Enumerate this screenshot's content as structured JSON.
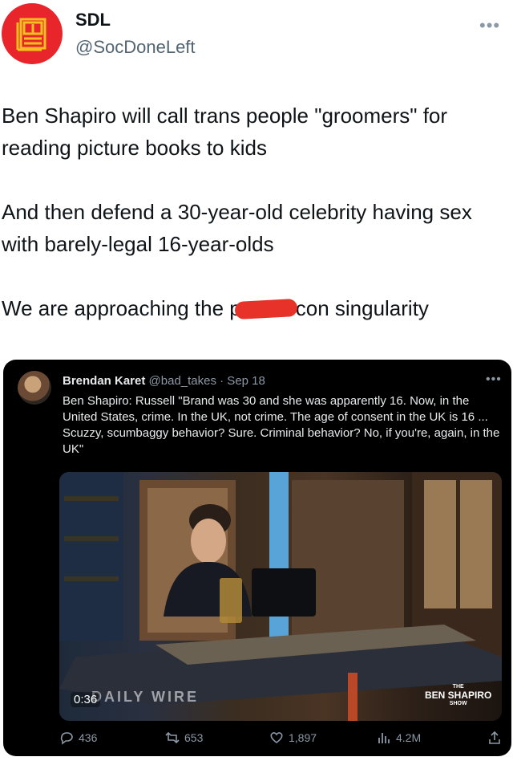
{
  "author": {
    "name": "SDL",
    "handle": "@SocDoneLeft",
    "avatar_color": "#e8252b"
  },
  "tweet": {
    "paragraph_1": "Ben Shapiro will call trans people \"groomers\" for reading picture books to kids",
    "paragraph_2": "And then defend a 30-year-old celebrity having sex with barely-legal 16-year-olds",
    "paragraph_3_before": "We are approaching the p",
    "paragraph_3_after": "con singularity"
  },
  "quoted": {
    "name": "Brendan Karet",
    "meta": "@bad_takes · Sep 18",
    "text": "Ben Shapiro: Russell \"Brand was 30 and she was apparently 16. Now, in the United States, crime. In the UK, not crime. The age of consent in the UK is 16 ... Scuzzy, scumbaggy behavior? Sure. Criminal behavior? No, if you're, again, in the UK\"",
    "video": {
      "timestamp": "0:36",
      "watermark": "DAILY WIRE",
      "brand_small": "THE",
      "brand_big": "BEN SHAPIRO",
      "brand_sub": "SHOW"
    },
    "actions": {
      "replies": "436",
      "retweets": "653",
      "likes": "1,897",
      "views": "4.2M"
    }
  },
  "icons": [
    "document-logo-icon",
    "more-icon",
    "reply-icon",
    "retweet-icon",
    "like-icon",
    "views-icon",
    "share-icon"
  ]
}
